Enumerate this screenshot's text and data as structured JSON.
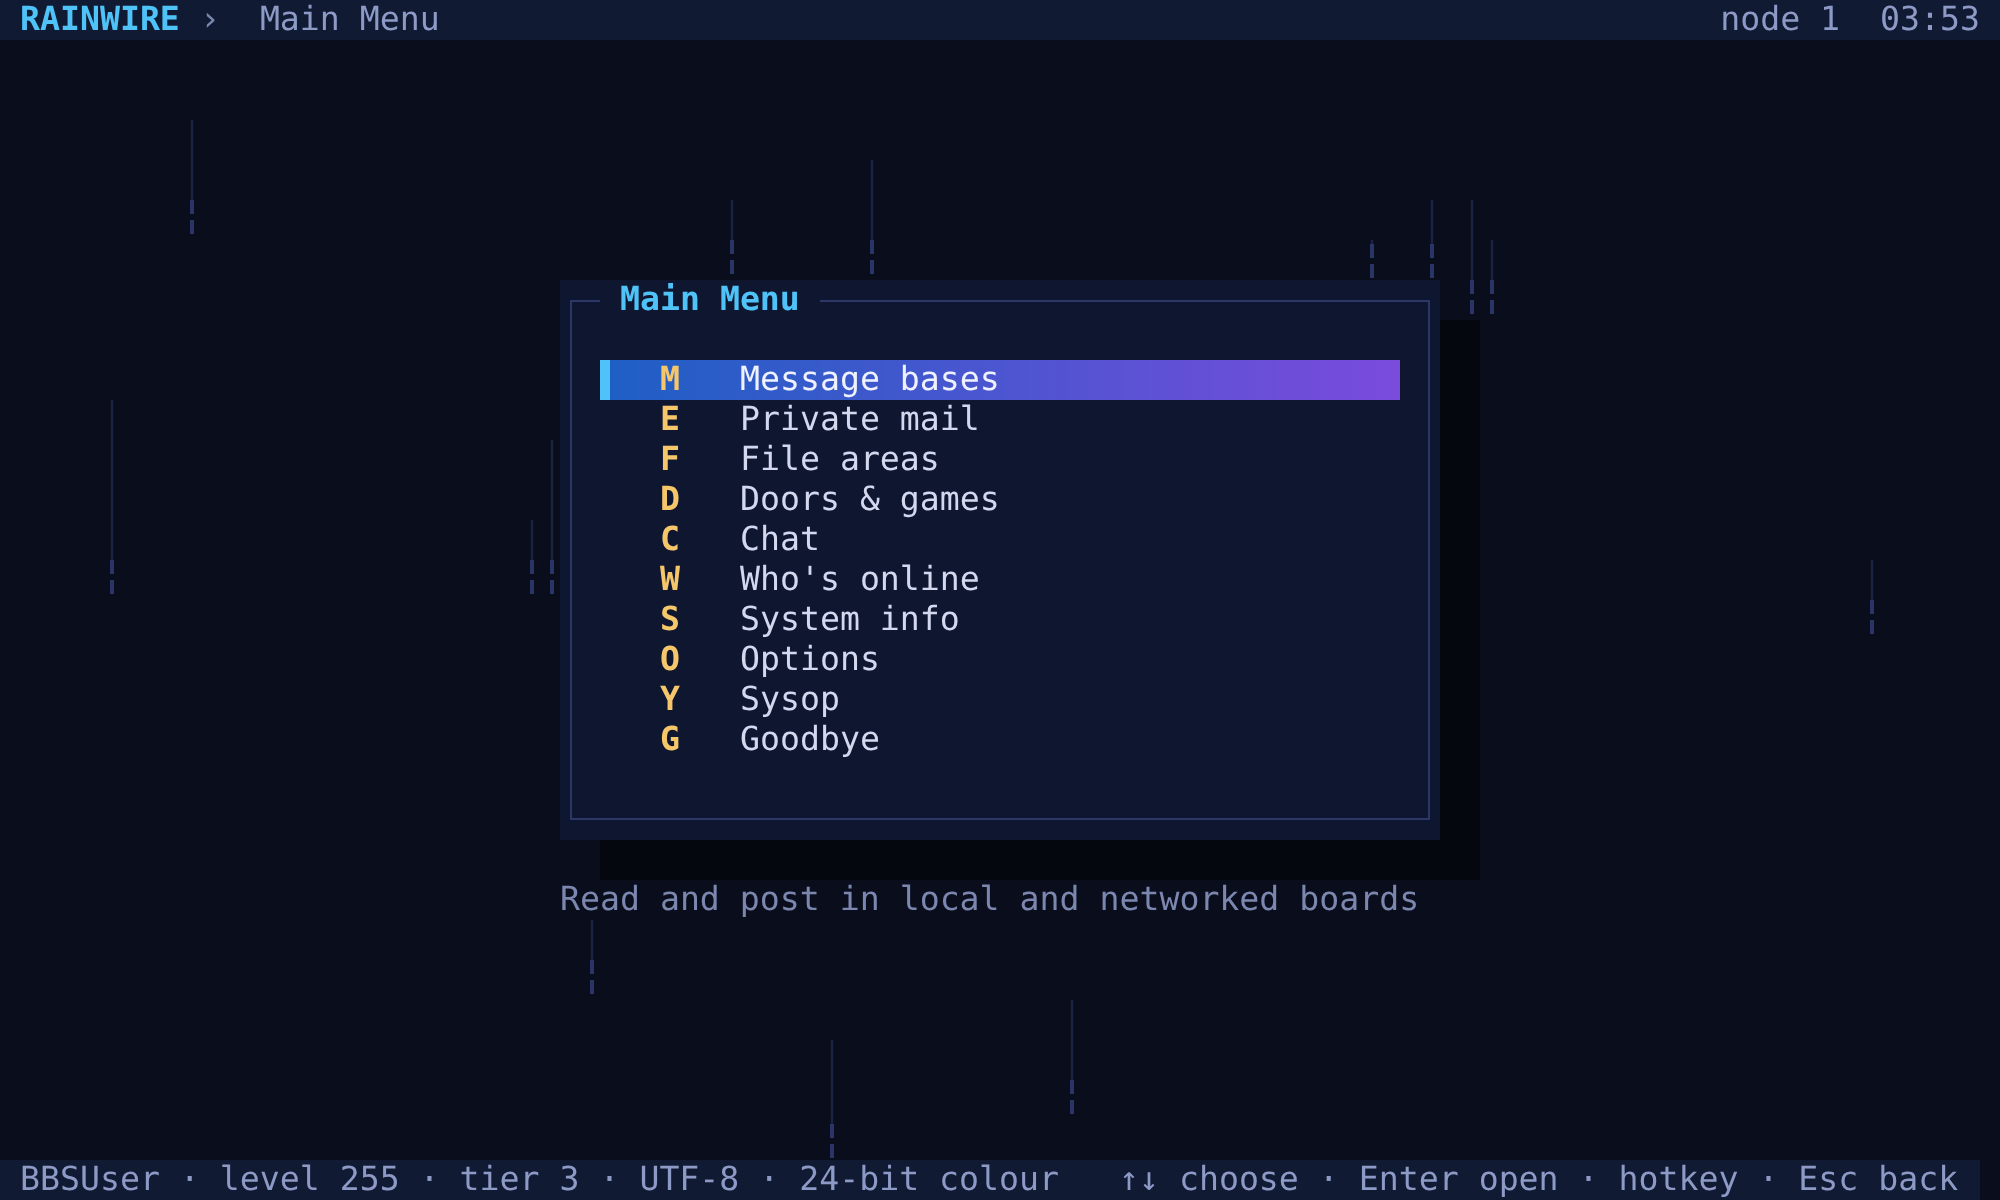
{
  "top_bar": {
    "brand": "RAINWIRE",
    "separator": "›",
    "location": "Main Menu",
    "node": "node 1",
    "time": "03:53"
  },
  "menu": {
    "title": "Main Menu",
    "items": [
      {
        "hotkey": "M",
        "label": "Message bases",
        "selected": true
      },
      {
        "hotkey": "E",
        "label": "Private mail",
        "selected": false
      },
      {
        "hotkey": "F",
        "label": "File areas",
        "selected": false
      },
      {
        "hotkey": "D",
        "label": "Doors & games",
        "selected": false
      },
      {
        "hotkey": "C",
        "label": "Chat",
        "selected": false
      },
      {
        "hotkey": "W",
        "label": "Who's online",
        "selected": false
      },
      {
        "hotkey": "S",
        "label": "System info",
        "selected": false
      },
      {
        "hotkey": "O",
        "label": "Options",
        "selected": false
      },
      {
        "hotkey": "Y",
        "label": "Sysop",
        "selected": false
      },
      {
        "hotkey": "G",
        "label": "Goodbye",
        "selected": false
      }
    ]
  },
  "item_description": "Read and post in local and networked boards",
  "status_bar": {
    "session": "BBSUser · level 255 · tier 3 · UTF-8 · 24-bit colour",
    "hints": "↑↓ choose · Enter open · hotkey · Esc back"
  }
}
